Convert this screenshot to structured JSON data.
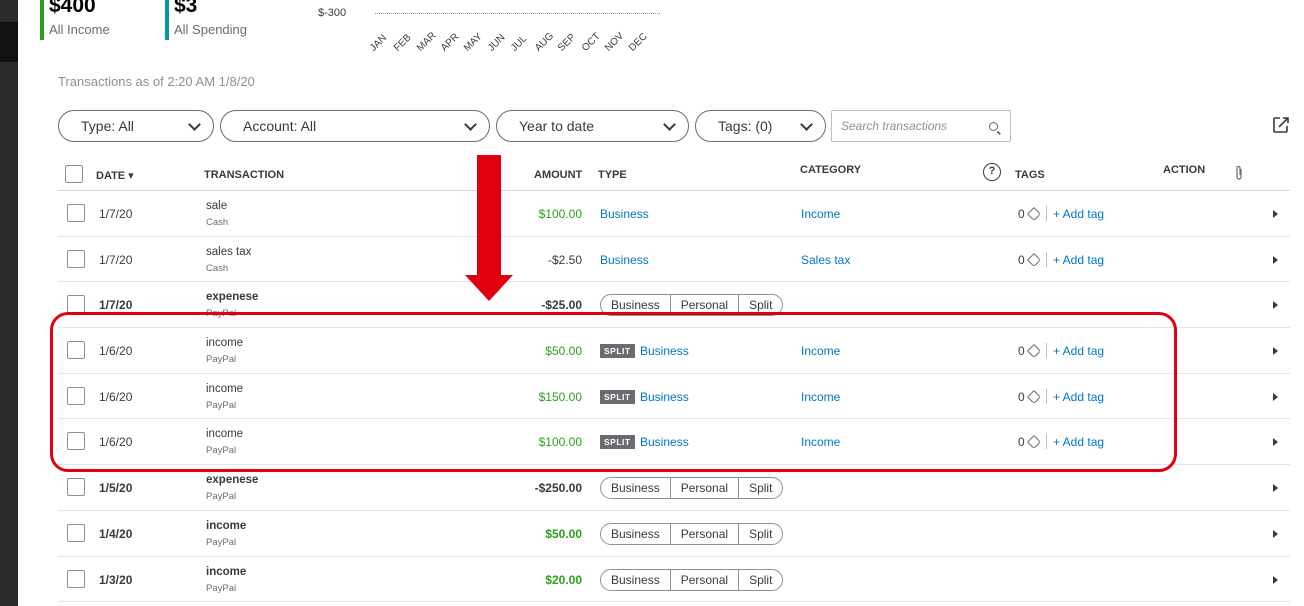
{
  "summary": {
    "income": {
      "value": "$400",
      "label": "All Income"
    },
    "spending": {
      "value": "$3",
      "label": "All Spending"
    }
  },
  "mini_chart": {
    "y_label": "$-300",
    "months": [
      "JAN",
      "FEB",
      "MAR",
      "APR",
      "MAY",
      "JUN",
      "JUL",
      "AUG",
      "SEP",
      "OCT",
      "NOV",
      "DEC"
    ]
  },
  "as_of": "Transactions as of 2:20 AM 1/8/20",
  "filters": {
    "type": "Type: All",
    "account": "Account: All",
    "period": "Year to date",
    "tags": "Tags: (0)",
    "search_placeholder": "Search transactions"
  },
  "columns": {
    "date": "DATE ▾",
    "transaction": "TRANSACTION",
    "amount": "AMOUNT",
    "type": "TYPE",
    "category": "CATEGORY",
    "help": "?",
    "tags": "TAGS",
    "action": "ACTION"
  },
  "segment_labels": {
    "business": "Business",
    "personal": "Personal",
    "split": "Split"
  },
  "split_badge": "SPLIT",
  "add_tag": "+ Add tag",
  "rows": [
    {
      "date": "1/7/20",
      "name": "sale",
      "account": "Cash",
      "amount": "$100.00",
      "type": "Business",
      "category": "Income",
      "tag_count": "0"
    },
    {
      "date": "1/7/20",
      "name": "sales tax",
      "account": "Cash",
      "amount": "-$2.50",
      "type": "Business",
      "category": "Sales tax",
      "tag_count": "0"
    },
    {
      "date": "1/7/20",
      "name": "expenese",
      "account": "PayPal",
      "amount": "-$25.00"
    },
    {
      "date": "1/6/20",
      "name": "income",
      "account": "PayPal",
      "amount": "$50.00",
      "type": "Business",
      "category": "Income",
      "tag_count": "0"
    },
    {
      "date": "1/6/20",
      "name": "income",
      "account": "PayPal",
      "amount": "$150.00",
      "type": "Business",
      "category": "Income",
      "tag_count": "0"
    },
    {
      "date": "1/6/20",
      "name": "income",
      "account": "PayPal",
      "amount": "$100.00",
      "type": "Business",
      "category": "Income",
      "tag_count": "0"
    },
    {
      "date": "1/5/20",
      "name": "expenese",
      "account": "PayPal",
      "amount": "-$250.00"
    },
    {
      "date": "1/4/20",
      "name": "income",
      "account": "PayPal",
      "amount": "$50.00"
    },
    {
      "date": "1/3/20",
      "name": "income",
      "account": "PayPal",
      "amount": "$20.00"
    }
  ],
  "colors": {
    "income_green": "#2ca01c",
    "link_blue": "#0077c5",
    "annotation_red": "#e0000f"
  }
}
